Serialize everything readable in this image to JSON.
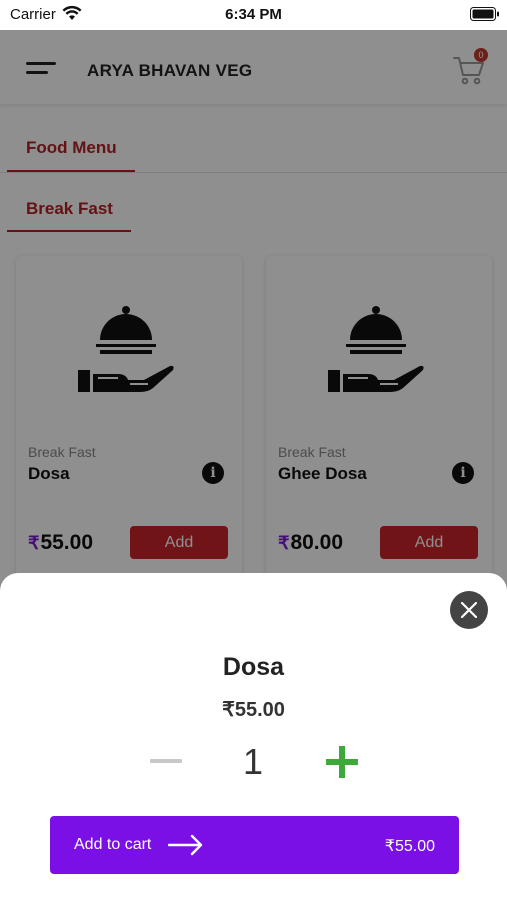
{
  "status": {
    "carrier": "Carrier",
    "time": "6:34 PM"
  },
  "header": {
    "title": "ARYA BHAVAN VEG",
    "cart_count": "0"
  },
  "tabs": {
    "primary": "Food Menu",
    "category": "Break Fast"
  },
  "items": [
    {
      "category": "Break Fast",
      "name": "Dosa",
      "price": "55.00",
      "add_label": "Add"
    },
    {
      "category": "Break Fast",
      "name": "Ghee Dosa",
      "price": "80.00",
      "add_label": "Add"
    }
  ],
  "currency_symbol": "₹",
  "sheet": {
    "name": "Dosa",
    "price": "₹55.00",
    "quantity": "1",
    "add_to_cart_label": "Add to cart",
    "total": "₹55.00"
  },
  "colors": {
    "accent_red": "#c8242b",
    "accent_purple": "#7a10e6",
    "plus_green": "#3ea83b"
  },
  "icons": [
    "wifi-icon",
    "battery-icon",
    "menu-icon",
    "cart-icon",
    "food-serving-icon",
    "info-icon",
    "close-icon",
    "arrow-right-icon"
  ]
}
